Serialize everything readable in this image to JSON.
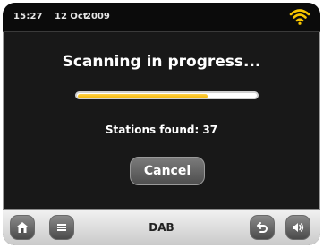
{
  "status_bar": {
    "time": "15:27",
    "date": "12 Oct",
    "year": "2009",
    "wifi_icon": "wifi-icon"
  },
  "scan": {
    "title": "Scanning in progress...",
    "progress_fraction": 0.73,
    "stations_found_text": "Stations found: 37",
    "cancel_label": "Cancel"
  },
  "bottom_bar": {
    "mode_label": "DAB",
    "buttons": [
      "home-icon",
      "menu-icon",
      "back-icon",
      "volume-icon"
    ]
  },
  "colors": {
    "accent": "#f0b200",
    "wifi": "#f5c400"
  }
}
